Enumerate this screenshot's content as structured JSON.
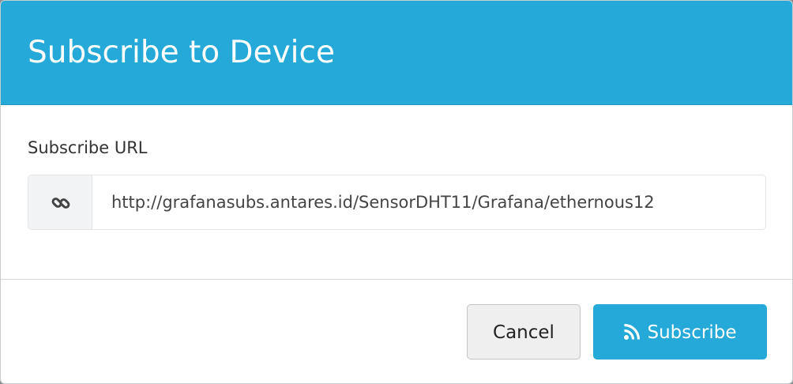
{
  "modal": {
    "title": "Subscribe to Device"
  },
  "form": {
    "label": "Subscribe URL",
    "url_value": "http://grafanasubs.antares.id/SensorDHT11/Grafana/ethernous12",
    "addon_icon": "link-icon"
  },
  "footer": {
    "cancel_label": "Cancel",
    "subscribe_label": "Subscribe",
    "subscribe_icon": "rss-icon"
  },
  "colors": {
    "header_bg": "#24a9d8",
    "primary_button": "#24a9d8",
    "cancel_button": "#efefef"
  }
}
